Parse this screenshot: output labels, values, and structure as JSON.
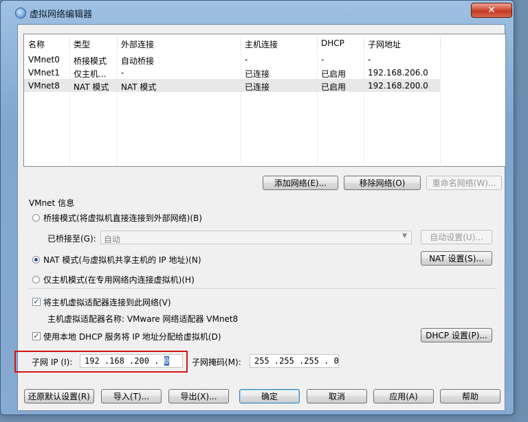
{
  "window": {
    "title": "虚拟网络编辑器",
    "close_symbol": "✕"
  },
  "table": {
    "headers": [
      "名称",
      "类型",
      "外部连接",
      "主机连接",
      "DHCP",
      "子网地址"
    ],
    "rows": [
      [
        "VMnet0",
        "桥接模式",
        "自动桥接",
        "-",
        "-",
        "-"
      ],
      [
        "VMnet1",
        "仅主机...",
        "-",
        "已连接",
        "已启用",
        "192.168.206.0"
      ],
      [
        "VMnet8",
        "NAT 模式",
        "NAT 模式",
        "已连接",
        "已启用",
        "192.168.200.0"
      ]
    ],
    "selected_row": 2
  },
  "network_buttons": {
    "add": "添加网络(E)...",
    "remove": "移除网络(O)",
    "rename": "重命名网络(W)..."
  },
  "vmnet_info": {
    "group_title": "VMnet 信息",
    "bridge_mode_label": "桥接模式(将虚拟机直接连接到外部网络)(B)",
    "bridged_to_label": "已桥接至(G):",
    "bridged_to_value": "自动",
    "auto_settings_button": "自动设置(U)...",
    "nat_mode_label": "NAT 模式(与虚拟机共享主机的 IP 地址)(N)",
    "nat_settings_button": "NAT 设置(S)...",
    "host_only_label": "仅主机模式(在专用网络内连接虚拟机)(H)",
    "selected_mode": "nat",
    "connect_adapter_label": "将主机虚拟适配器连接到此网络(V)",
    "connect_adapter_checked": true,
    "adapter_name_text": "主机虚拟适配器名称: VMware 网络适配器 VMnet8",
    "use_dhcp_label": "使用本地 DHCP 服务将 IP 地址分配给虚拟机(D)",
    "use_dhcp_checked": true,
    "dhcp_settings_button": "DHCP 设置(P)...",
    "subnet_ip_label": "子网 IP (I):",
    "subnet_ip_prefix": "192 .168 .200 . ",
    "subnet_ip_last": "0",
    "subnet_mask_label": "子网掩码(M):",
    "subnet_mask_value": "255 .255 .255 . 0"
  },
  "footer_buttons": {
    "restore_defaults": "还原默认设置(R)",
    "import": "导入(T)...",
    "export": "导出(X)...",
    "ok": "确定",
    "cancel": "取消",
    "apply": "应用(A)",
    "help": "帮助"
  },
  "colors": {
    "highlight_box": "#d21414",
    "selection": "#3a75c4"
  }
}
